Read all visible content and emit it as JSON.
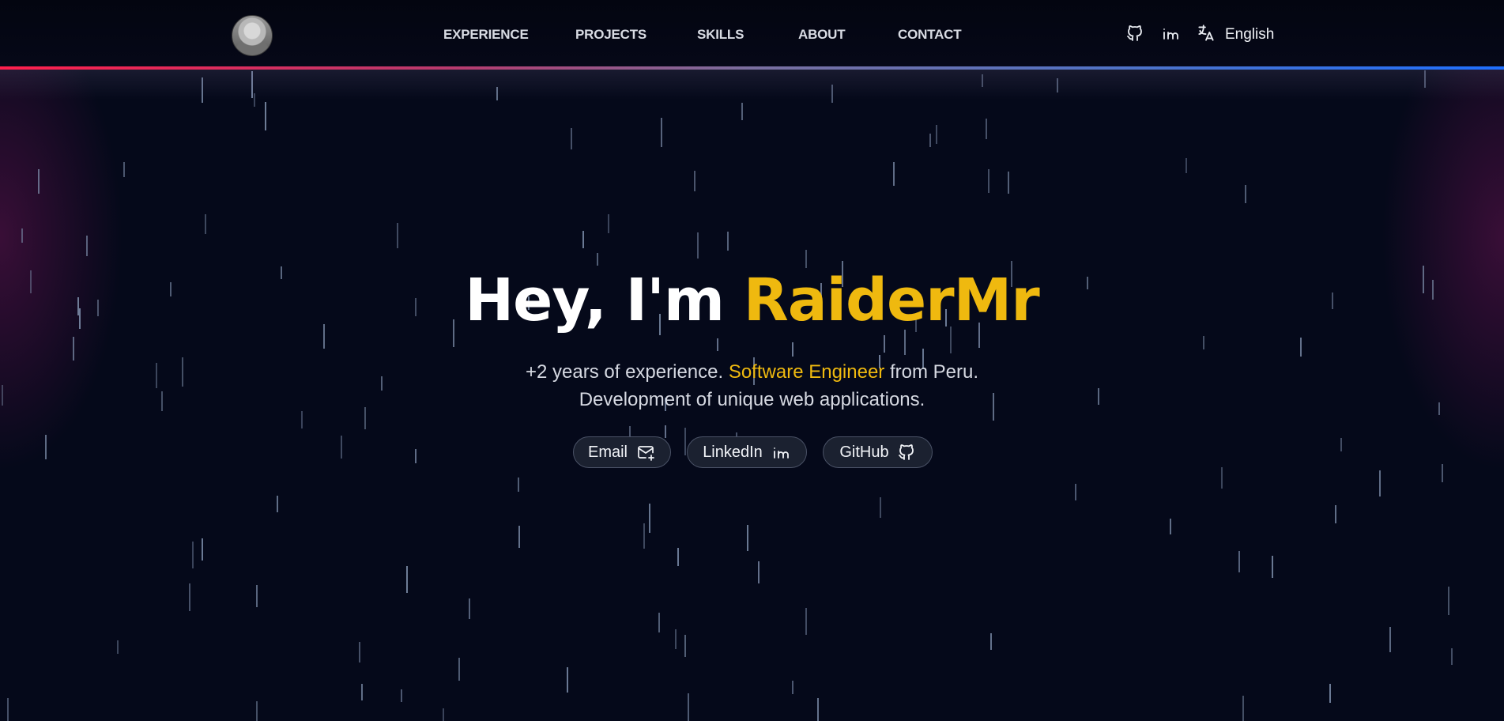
{
  "header": {
    "avatar_alt": "Profile photo",
    "nav": [
      {
        "label": "EXPERIENCE"
      },
      {
        "label": "PROJECTS"
      },
      {
        "label": "SKILLS"
      },
      {
        "label": "ABOUT"
      },
      {
        "label": "CONTACT"
      }
    ],
    "icons": [
      "github-icon",
      "linkedin-icon",
      "translate-icon"
    ],
    "language": "English"
  },
  "hero": {
    "title_prefix": "Hey, I'm ",
    "title_name": "RaiderMr",
    "subtitle_line1_prefix": "+2 years of experience. ",
    "subtitle_line1_accent": "Software Engineer",
    "subtitle_line1_suffix": " from Peru.",
    "subtitle_line2": "Development of unique web applications.",
    "buttons": [
      {
        "label": "Email",
        "icon": "mail-plus-icon"
      },
      {
        "label": "LinkedIn",
        "icon": "linkedin-icon"
      },
      {
        "label": "GitHub",
        "icon": "github-icon"
      }
    ]
  },
  "colors": {
    "background": "#05091a",
    "accent": "#efb90f",
    "header_line_left": "#ff1f4d",
    "header_line_right": "#1f6fff",
    "rain": "#7a8aa6"
  }
}
